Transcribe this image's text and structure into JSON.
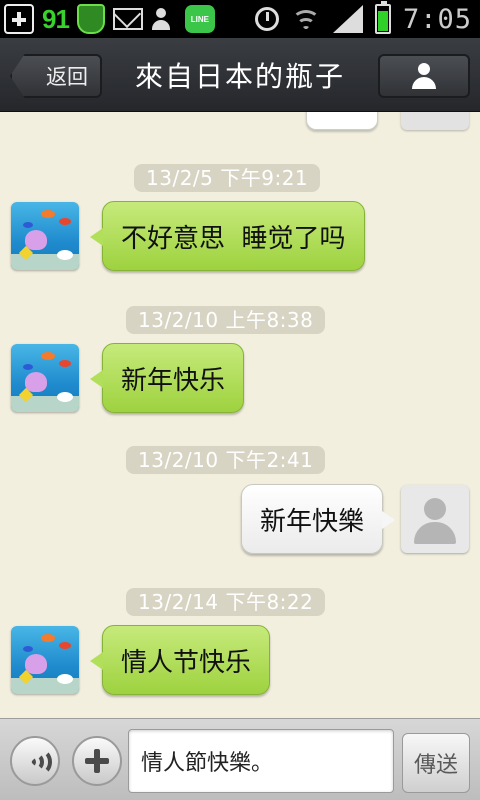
{
  "status_bar": {
    "left_icons": [
      "add-icon",
      "91-badge-icon",
      "shield-icon",
      "mail-icon",
      "add-contact-icon",
      "line-icon"
    ],
    "badge_text": "91",
    "line_label": "LINE",
    "right_icons": [
      "alarm-icon",
      "wifi-icon",
      "signal-icon",
      "battery-icon"
    ],
    "time": "7:05"
  },
  "header": {
    "back_label": "返回",
    "title": "來自日本的瓶子",
    "profile_icon": "person-icon"
  },
  "messages": [
    {
      "type": "timestamp",
      "text": "13/2/5 下午9:21"
    },
    {
      "type": "incoming",
      "text": "不好意思  睡觉了吗"
    },
    {
      "type": "timestamp",
      "text": "13/2/10 上午8:38"
    },
    {
      "type": "incoming",
      "text": "新年快乐"
    },
    {
      "type": "timestamp",
      "text": "13/2/10 下午2:41"
    },
    {
      "type": "outgoing",
      "text": "新年快樂"
    },
    {
      "type": "timestamp",
      "text": "13/2/14 下午8:22"
    },
    {
      "type": "incoming",
      "text": "情人节快乐"
    }
  ],
  "input_bar": {
    "voice_icon": "voice-icon",
    "plus_icon": "plus-icon",
    "input_value": "情人節快樂。",
    "send_label": "傳送"
  },
  "colors": {
    "chat_background": "#f2efdf",
    "incoming_bubble": "#a8d84a",
    "outgoing_bubble": "#ffffff",
    "timestamp_pill": "#d8d4c4",
    "header": "#2e3035"
  }
}
